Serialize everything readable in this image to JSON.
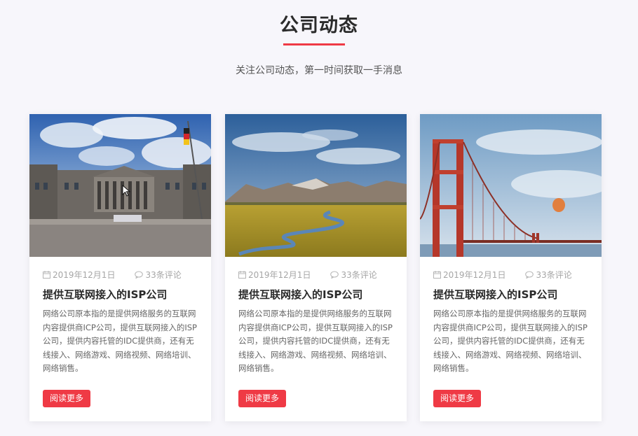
{
  "section": {
    "title": "公司动态",
    "subtitle": "关注公司动态，第一时间获取一手消息",
    "accent_color": "#ef3a45"
  },
  "cards": [
    {
      "image": "reichstag-building-photo",
      "date": "2019年12月1日",
      "comments": "33条评论",
      "title": "提供互联网接入的ISP公司",
      "text": "网络公司原本指的是提供网络服务的互联网内容提供商ICP公司，提供互联网接入的ISP公司，提供内容托管的IDC提供商，还有无线接入、网络游戏、网络视频、网络培训、网络销售。",
      "button": "阅读更多"
    },
    {
      "image": "mountain-valley-river-photo",
      "date": "2019年12月1日",
      "comments": "33条评论",
      "title": "提供互联网接入的ISP公司",
      "text": "网络公司原本指的是提供网络服务的互联网内容提供商ICP公司，提供互联网接入的ISP公司，提供内容托管的IDC提供商，还有无线接入、网络游戏、网络视频、网络培训、网络销售。",
      "button": "阅读更多"
    },
    {
      "image": "golden-gate-bridge-photo",
      "date": "2019年12月1日",
      "comments": "33条评论",
      "title": "提供互联网接入的ISP公司",
      "text": "网络公司原本指的是提供网络服务的互联网内容提供商ICP公司，提供互联网接入的ISP公司，提供内容托管的IDC提供商，还有无线接入、网络游戏、网络视频、网络培训、网络销售。",
      "button": "阅读更多"
    }
  ]
}
